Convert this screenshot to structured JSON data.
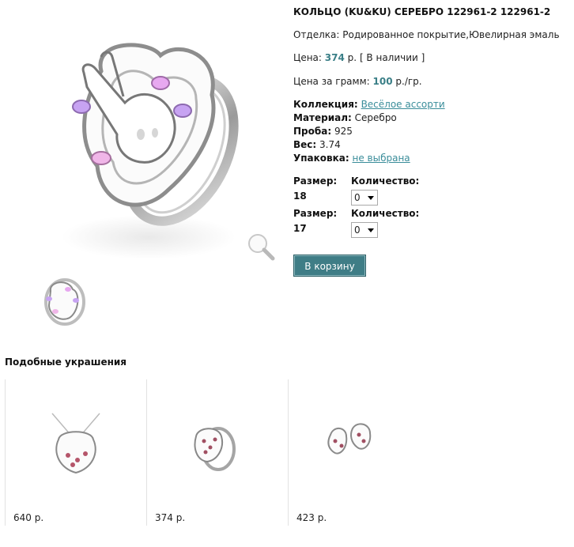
{
  "product": {
    "title": "КОЛЬЦО (KU&KU) СЕРЕБРО 122961-2 122961-2",
    "finish_label": "Отделка:",
    "finish_value": "Родированное покрытие,Ювелирная эмаль",
    "price_label": "Цена:",
    "price_value": "374",
    "price_unit": "р.",
    "stock": "[ В наличии ]",
    "per_gram_label": "Цена за грамм:",
    "per_gram_value": "100",
    "per_gram_unit": "р./гр.",
    "collection_label": "Коллекция:",
    "collection_value": "Весёлое ассорти",
    "material_label": "Материал:",
    "material_value": "Серебро",
    "probe_label": "Проба:",
    "probe_value": "925",
    "weight_label": "Вес:",
    "weight_value": "3.74",
    "package_label": "Упаковка:",
    "package_value": "не выбрана"
  },
  "sizes": [
    {
      "size_label": "Размер:",
      "size_value": "18",
      "qty_label": "Количество:",
      "qty_value": "0"
    },
    {
      "size_label": "Размер:",
      "size_value": "17",
      "qty_label": "Количество:",
      "qty_value": "0"
    }
  ],
  "cart_button": "В корзину",
  "similar": {
    "heading": "Подобные украшения",
    "items": [
      {
        "price": "640 р.",
        "image": "pendant"
      },
      {
        "price": "374 р.",
        "image": "ring"
      },
      {
        "price": "423 р.",
        "image": "earrings"
      }
    ]
  },
  "icons": {
    "zoom": "magnifier-icon",
    "select": "chevron-down-icon"
  },
  "colors": {
    "accent": "#3a7f87",
    "link": "#3a8d9a",
    "button": "#3f7d86"
  }
}
